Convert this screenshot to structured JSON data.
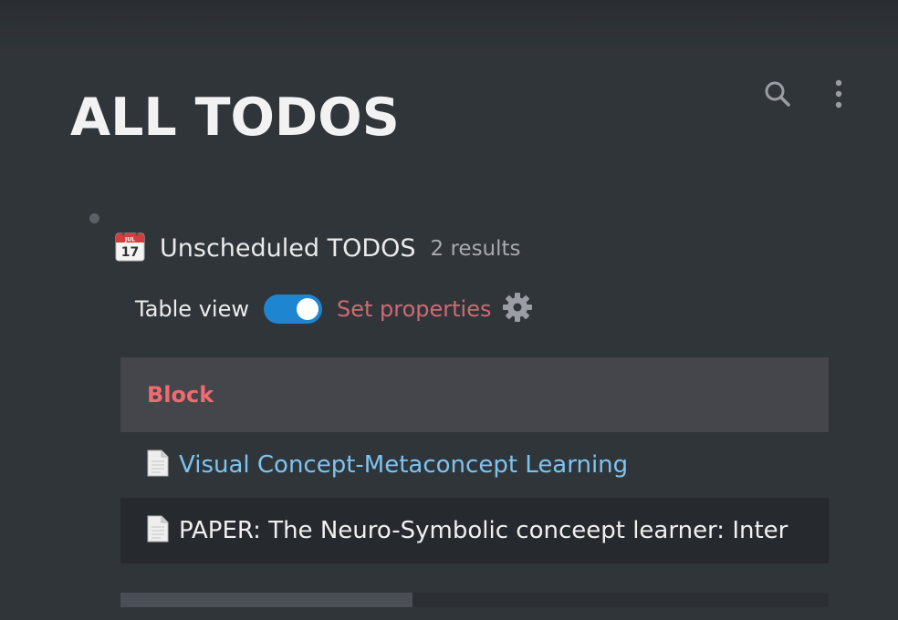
{
  "header": {
    "title": "ALL TODOS",
    "actions": [
      {
        "icon": "search-icon"
      },
      {
        "icon": "more-vertical-icon"
      }
    ]
  },
  "query": {
    "icon": "calendar-icon",
    "calendar_icon_month": "JUL",
    "calendar_icon_day": "17",
    "title": "Unscheduled TODOS",
    "result_count": "2 results",
    "table_view_label": "Table view",
    "table_view_enabled": true,
    "set_properties_label": "Set properties"
  },
  "table": {
    "columns": [
      "Block"
    ],
    "rows": [
      {
        "icon": "page-icon",
        "text": "Visual Concept-Metaconcept Learning",
        "is_link": true
      },
      {
        "icon": "page-icon",
        "text": "PAPER: The Neuro-Symbolic conceept learner: Inter",
        "is_link": false
      }
    ]
  },
  "colors": {
    "background": "#30353a",
    "title": "#f2f2f2",
    "toggle_on": "#1e86d0",
    "set_properties": "#cf6a70",
    "column_header": "#f06b6f",
    "link": "#7ec3ee",
    "table_header_bg": "#45464c",
    "alt_row_bg": "#26292e"
  }
}
